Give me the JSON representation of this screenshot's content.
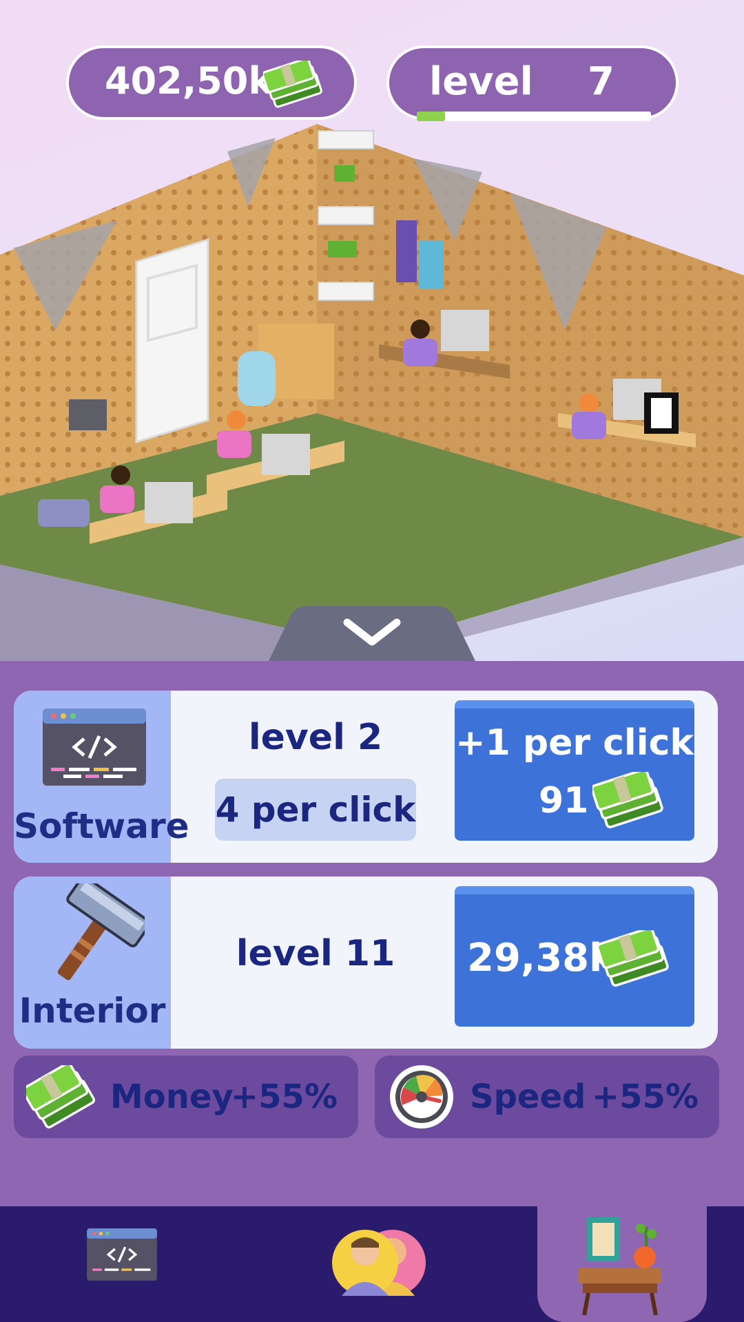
{
  "hud": {
    "money_value": "402,50k",
    "money_icon": "cash-stack-icon",
    "level_label": "level",
    "level_number": "7",
    "level_progress": 0.12
  },
  "scene": {
    "collapse_icon": "chevron-down-icon"
  },
  "upgrades": [
    {
      "title": "Software",
      "icon": "code-window-icon",
      "level": "level 2",
      "rate": "4 per click",
      "button_line1": "+1 per click",
      "button_price": "91",
      "price_icon": "cash-stack-icon"
    },
    {
      "title": "Interior",
      "icon": "hammer-icon",
      "level": "level 11",
      "button_price": "29,38k",
      "price_icon": "cash-stack-icon"
    }
  ],
  "boosts": [
    {
      "label": "Money",
      "value": "+55%",
      "icon": "cash-stack-icon"
    },
    {
      "label": "Speed",
      "value": "+55%",
      "icon": "speedometer-icon"
    }
  ],
  "nav": {
    "items": [
      {
        "icon": "code-window-icon",
        "active": false
      },
      {
        "icon": "team-avatars-icon",
        "active": false
      },
      {
        "icon": "furniture-icon",
        "active": true
      }
    ]
  },
  "colors": {
    "panel": "#8e66b2",
    "navbar": "#2b1b6c",
    "button": "#3d73d8",
    "text_dark": "#1b2680",
    "floor": "#6f8a46"
  }
}
